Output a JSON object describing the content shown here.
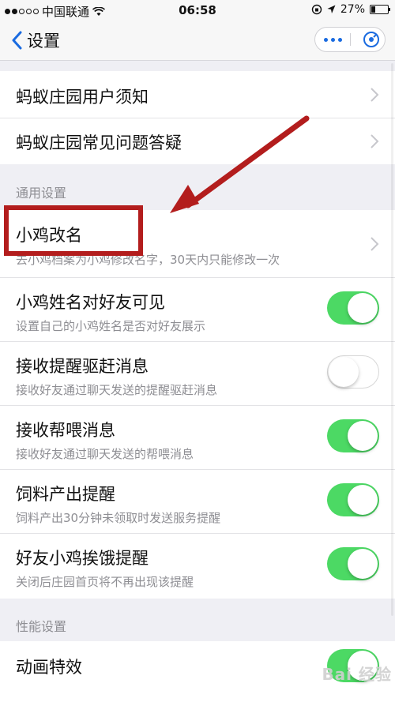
{
  "status_bar": {
    "carrier": "中国联通",
    "time": "06:58",
    "battery": "27%",
    "battery_fraction": 0.27
  },
  "nav": {
    "title": "设置"
  },
  "group_top": [
    {
      "title": "蚂蚁庄园用户须知"
    },
    {
      "title": "蚂蚁庄园常见问题答疑"
    }
  ],
  "section_general": "通用设置",
  "general": [
    {
      "title": "小鸡改名",
      "subtitle": "去小鸡档案为小鸡修改名字，30天内只能修改一次"
    },
    {
      "title": "小鸡姓名对好友可见",
      "subtitle": "设置自己的小鸡姓名是否对好友展示",
      "on": true
    },
    {
      "title": "接收提醒驱赶消息",
      "subtitle": "接收好友通过聊天发送的提醒驱赶消息",
      "on": false
    },
    {
      "title": "接收帮喂消息",
      "subtitle": "接收好友通过聊天发送的帮喂消息",
      "on": true
    },
    {
      "title": "饲料产出提醒",
      "subtitle": "饲料产出30分钟未领取时发送服务提醒",
      "on": true
    },
    {
      "title": "好友小鸡挨饿提醒",
      "subtitle": "关闭后庄园首页将不再出现该提醒",
      "on": true
    }
  ],
  "section_performance": "性能设置",
  "performance": [
    {
      "title": "动画特效",
      "on": true
    }
  ],
  "watermark": "Bai 经验",
  "colors": {
    "toggle_on": "#4cd964",
    "annotation_red": "#b31d1d",
    "accent_blue": "#1a6be0"
  }
}
